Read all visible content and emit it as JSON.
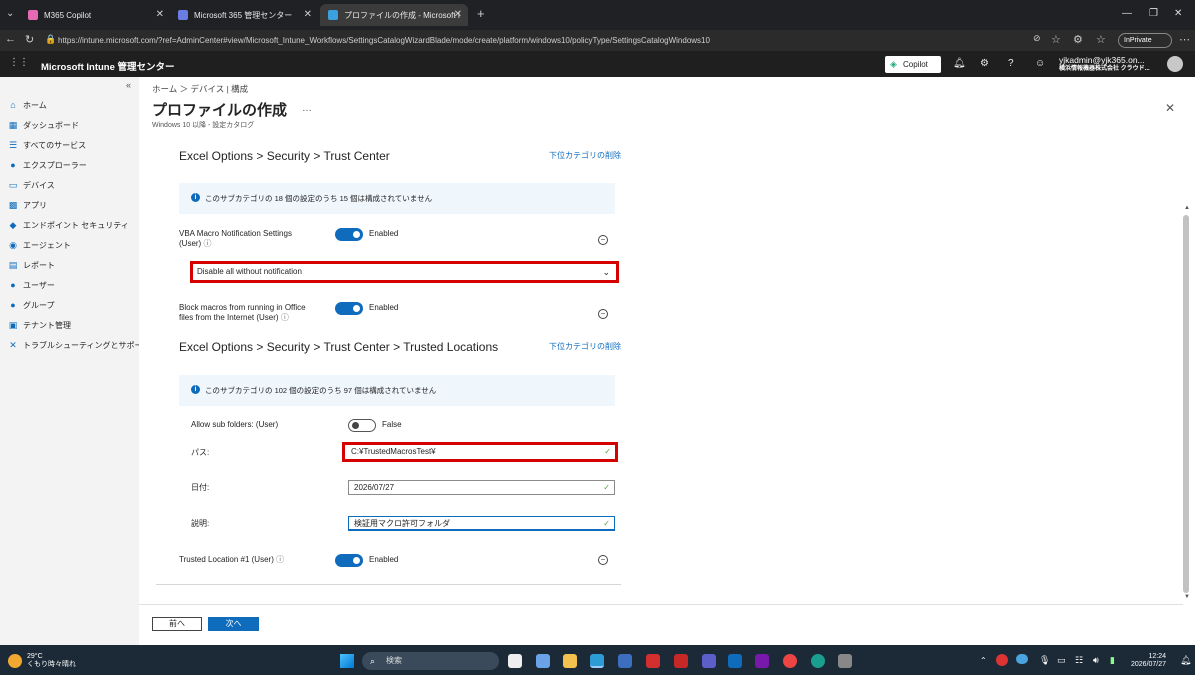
{
  "browser": {
    "tabs": [
      {
        "title": "M365 Copilot",
        "fav_color": "#e36ab3"
      },
      {
        "title": "Microsoft 365 管理センター",
        "fav_color": "#6a7de3"
      },
      {
        "title": "プロファイルの作成 - Microsoft Intune",
        "fav_color": "#3ba0e0"
      }
    ],
    "url": "https://intune.microsoft.com/?ref=AdminCenter#view/Microsoft_Intune_Workflows/SettingsCatalogWizardBlade/mode/create/platform/windows10/policyType/SettingsCatalogWindows10",
    "inprivate": "InPrivate"
  },
  "header": {
    "brand": "Microsoft Intune 管理センター",
    "copilot": "Copilot",
    "user_name": "yjkadmin@yjk365.on...",
    "user_org": "横浜情報機器株式会社 クラウド..."
  },
  "sidebar": {
    "items": [
      {
        "label": "ホーム",
        "icon": "⌂"
      },
      {
        "label": "ダッシュボード",
        "icon": "▦"
      },
      {
        "label": "すべてのサービス",
        "icon": "☰"
      },
      {
        "label": "エクスプローラー",
        "icon": "●"
      },
      {
        "label": "デバイス",
        "icon": "▭"
      },
      {
        "label": "アプリ",
        "icon": "▩"
      },
      {
        "label": "エンドポイント セキュリティ",
        "icon": "◆"
      },
      {
        "label": "エージェント",
        "icon": "◉"
      },
      {
        "label": "レポート",
        "icon": "▤"
      },
      {
        "label": "ユーザー",
        "icon": "●"
      },
      {
        "label": "グループ",
        "icon": "●"
      },
      {
        "label": "テナント管理",
        "icon": "▣"
      },
      {
        "label": "トラブルシューティングとサポート",
        "icon": "✕"
      }
    ]
  },
  "page": {
    "breadcrumb": "ホーム ＞ デバイス | 構成",
    "title": "プロファイルの作成",
    "more": "…",
    "subtitle": "Windows 10 以降 - 設定カタログ"
  },
  "section1": {
    "heading": "Excel Options > Security > Trust Center",
    "delete_link": "下位カテゴリの削除",
    "info": "このサブカテゴリの 18 個の設定のうち 15 個は構成されていません",
    "setting1_label1": "VBA Macro Notification Settings",
    "setting1_label2": "(User)",
    "setting1_state": "Enabled",
    "dropdown_value": "Disable all without notification",
    "setting2_label1": "Block macros from running in Office",
    "setting2_label2": "files from the Internet (User)",
    "setting2_state": "Enabled"
  },
  "section2": {
    "heading": "Excel Options > Security > Trust Center > Trusted Locations",
    "delete_link": "下位カテゴリの削除",
    "info": "このサブカテゴリの 102 個の設定のうち 97 個は構成されていません",
    "allow_label": "Allow sub folders: (User)",
    "allow_state": "False",
    "path_label": "パス:",
    "path_value": "C:¥TrustedMacrosTest¥",
    "date_label": "日付:",
    "date_value": "2026/07/27",
    "desc_label": "説明:",
    "desc_value": "検証用マクロ許可フォルダ",
    "trusted_label": "Trusted Location #1 (User)",
    "trusted_state": "Enabled"
  },
  "footer": {
    "prev": "前へ",
    "next": "次へ"
  },
  "taskbar": {
    "temp": "29°C",
    "weather": "くもり時々晴れ",
    "search": "検索",
    "time": "12:24",
    "date": "2026/07/27"
  }
}
